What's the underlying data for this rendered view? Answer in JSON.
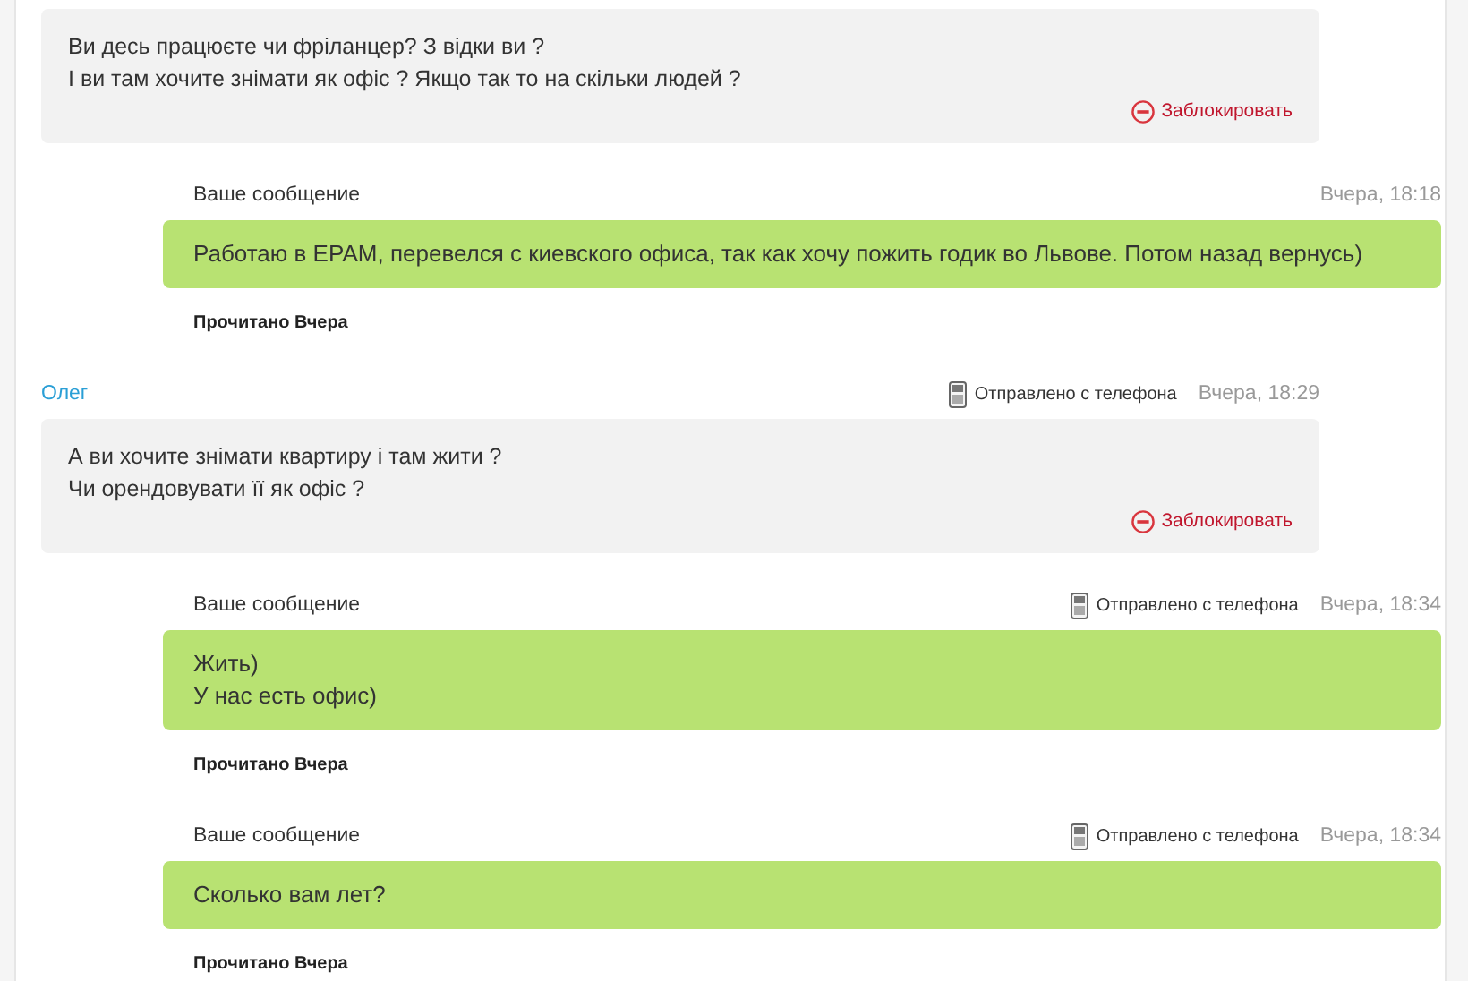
{
  "messages": [
    {
      "kind": "incoming",
      "lines": [
        "Ви десь працюєте чи фріланцер? З відки ви ?",
        "І ви там хочите знімати як офіс ? Якщо так то на скільки людей ?"
      ],
      "block_label": "Заблокировать"
    },
    {
      "kind": "outgoing",
      "author": "Ваше сообщение",
      "time": "Вчера, 18:18",
      "lines": [
        "Работаю в ЕРАМ, перевелся с киевского офиса, так как хочу пожить годик во Львове. Потом назад вернусь)"
      ],
      "read_status": "Прочитано Вчера"
    },
    {
      "kind": "incoming",
      "author": "Олег",
      "via_phone": "Отправлено с телефона",
      "time": "Вчера, 18:29",
      "lines": [
        "А ви хочите знімати квартиру і там жити ?",
        "Чи орендовувати її як офіс ?"
      ],
      "block_label": "Заблокировать"
    },
    {
      "kind": "outgoing",
      "author": "Ваше сообщение",
      "via_phone": "Отправлено с телефона",
      "time": "Вчера, 18:34",
      "lines": [
        "Жить)",
        "У нас есть офис)"
      ],
      "read_status": "Прочитано Вчера"
    },
    {
      "kind": "outgoing",
      "author": "Ваше сообщение",
      "via_phone": "Отправлено с телефона",
      "time": "Вчера, 18:34",
      "lines": [
        "Сколько вам лет?"
      ],
      "read_status": "Прочитано Вчера"
    }
  ]
}
